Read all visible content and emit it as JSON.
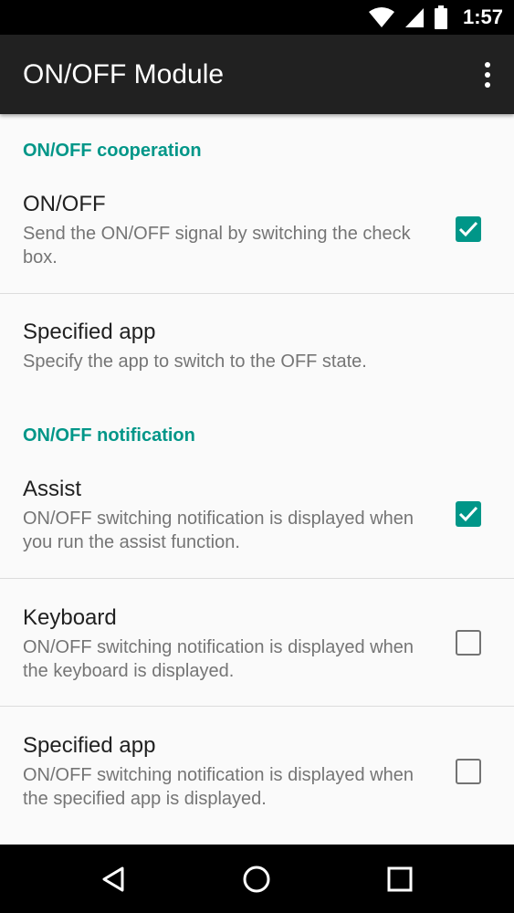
{
  "status_bar": {
    "time": "1:57",
    "icons": [
      "wifi-icon",
      "signal-icon",
      "battery-icon"
    ]
  },
  "app_bar": {
    "title": "ON/OFF Module",
    "menu_icon": "overflow-menu-icon"
  },
  "sections": [
    {
      "header": "ON/OFF cooperation",
      "items": [
        {
          "title": "ON/OFF",
          "summary": "Send the ON/OFF signal by switching the check box.",
          "checkbox": true
        },
        {
          "title": "Specified app",
          "summary": "Specify the app to switch to the OFF state.",
          "checkbox": null
        }
      ]
    },
    {
      "header": "ON/OFF notification",
      "items": [
        {
          "title": "Assist",
          "summary": "ON/OFF switching notification is displayed when you run the assist function.",
          "checkbox": true
        },
        {
          "title": "Keyboard",
          "summary": "ON/OFF switching notification is displayed when the keyboard is displayed.",
          "checkbox": false
        },
        {
          "title": "Specified app",
          "summary": "ON/OFF switching notification is displayed when the specified app is displayed.",
          "checkbox": false
        }
      ]
    }
  ],
  "colors": {
    "accent": "#009688",
    "app_bar": "#212121",
    "status_bar": "#000000",
    "background": "#fafafa"
  },
  "nav_bar": {
    "icons": [
      "back-icon",
      "home-icon",
      "recents-icon"
    ]
  }
}
